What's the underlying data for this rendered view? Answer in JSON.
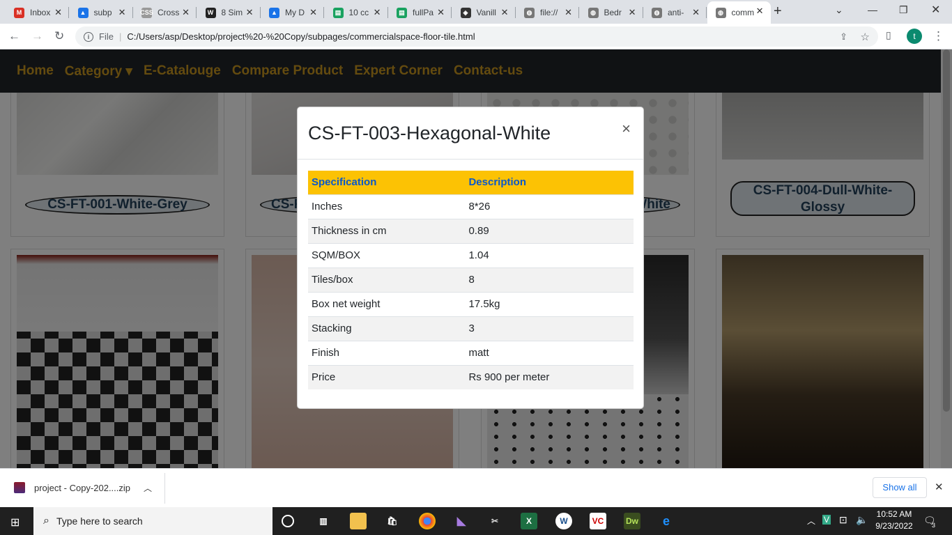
{
  "tabs": [
    {
      "title": "Inbox",
      "color": "#d93025",
      "glyph": "M"
    },
    {
      "title": "subp",
      "color": "#1a73e8",
      "glyph": "▲"
    },
    {
      "title": "Cross",
      "color": "#999",
      "glyph": "CSS"
    },
    {
      "title": "8 Sim",
      "color": "#222",
      "glyph": "W"
    },
    {
      "title": "My D",
      "color": "#1a73e8",
      "glyph": "▲"
    },
    {
      "title": "10 cc",
      "color": "#1aa260",
      "glyph": "▤"
    },
    {
      "title": "fullPa",
      "color": "#1aa260",
      "glyph": "▤"
    },
    {
      "title": "Vanill",
      "color": "#333",
      "glyph": "◈"
    },
    {
      "title": "file://",
      "color": "#777",
      "glyph": "◍"
    },
    {
      "title": "Bedr",
      "color": "#777",
      "glyph": "◍"
    },
    {
      "title": "anti-",
      "color": "#777",
      "glyph": "◍"
    },
    {
      "title": "comm",
      "color": "#777",
      "glyph": "◍"
    }
  ],
  "browser": {
    "file_label": "File",
    "url": "C:/Users/asp/Desktop/project%20-%20Copy/subpages/commercialspace-floor-tile.html",
    "profile": "t"
  },
  "nav": {
    "home": "Home",
    "category": "Category ▾",
    "ecatalogue": "E-Catalouge",
    "compare": "Compare Product",
    "expert": "Expert Corner",
    "contact": "Contact-us"
  },
  "cards": {
    "c1": "CS-FT-001-White-Grey",
    "c2": "CS-F",
    "c3": "White",
    "c4": "CS-FT-004-Dull-White-Glossy"
  },
  "modal": {
    "title": "CS-FT-003-Hexagonal-White",
    "close": "×",
    "headers": [
      "Specification",
      "Description"
    ],
    "rows": [
      [
        "Inches",
        "8*26"
      ],
      [
        "Thickness in cm",
        "0.89"
      ],
      [
        "SQM/BOX",
        "1.04"
      ],
      [
        "Tiles/box",
        "8"
      ],
      [
        "Box net weight",
        "17.5kg"
      ],
      [
        "Stacking",
        "3"
      ],
      [
        "Finish",
        "matt"
      ],
      [
        "Price",
        "Rs 900 per meter"
      ]
    ]
  },
  "download": {
    "file": "project - Copy-202....zip",
    "show_all": "Show all"
  },
  "taskbar": {
    "search_placeholder": "Type here to search",
    "time": "10:52 AM",
    "date": "9/23/2022",
    "notifications": "3"
  }
}
